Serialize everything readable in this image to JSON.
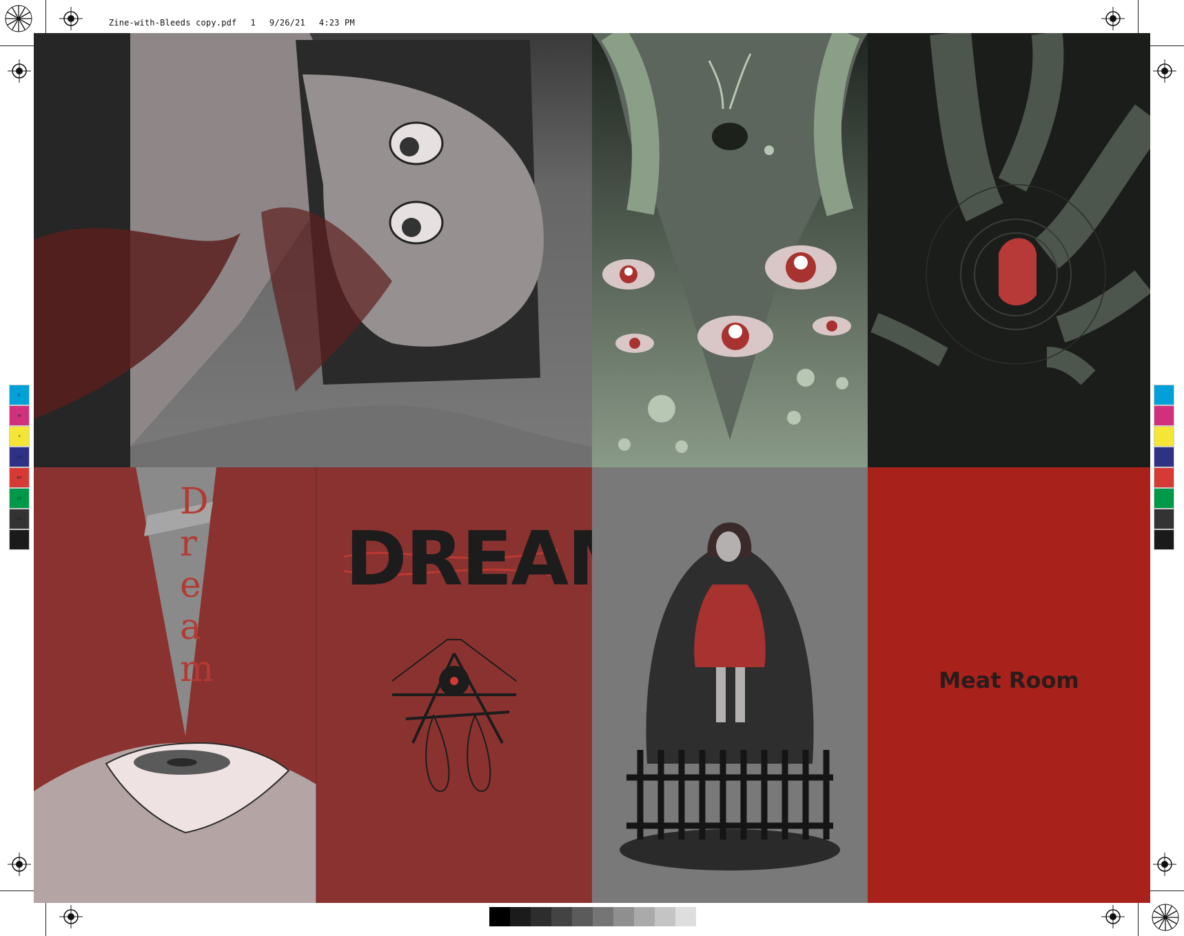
{
  "header": {
    "filename": "Zine-with-Bleeds copy.pdf",
    "page": "1",
    "date": "9/26/21",
    "time": "4:23 PM"
  },
  "color_bar_left": [
    {
      "label": "C",
      "color": "#00a0d8"
    },
    {
      "label": "M",
      "color": "#d0307c"
    },
    {
      "label": "Y",
      "color": "#f4e636"
    },
    {
      "label": "CM",
      "color": "#2e3184"
    },
    {
      "label": "MY",
      "color": "#d63a34"
    },
    {
      "label": "CY",
      "color": "#00994a"
    },
    {
      "label": "CMY",
      "color": "#333333"
    },
    {
      "label": "K",
      "color": "#1a1a1a"
    }
  ],
  "gray_ramp": [
    "#000000",
    "#1b1b1b",
    "#2d2d2d",
    "#434343",
    "#5b5b5b",
    "#757575",
    "#8f8f8f",
    "#aaaaaa",
    "#c4c4c4",
    "#dedede"
  ],
  "panels": {
    "dream_vertical": [
      "D",
      "r",
      "e",
      "a",
      "m"
    ],
    "dream_title": "DREAM",
    "meat_room": "Meat Room"
  },
  "colors": {
    "panel_red": "#8a3230",
    "meat_red": "#a8211b",
    "gray_panel": "#797979",
    "green_panel": "#5f6c5f",
    "dark_panel": "#1b1d1a"
  }
}
